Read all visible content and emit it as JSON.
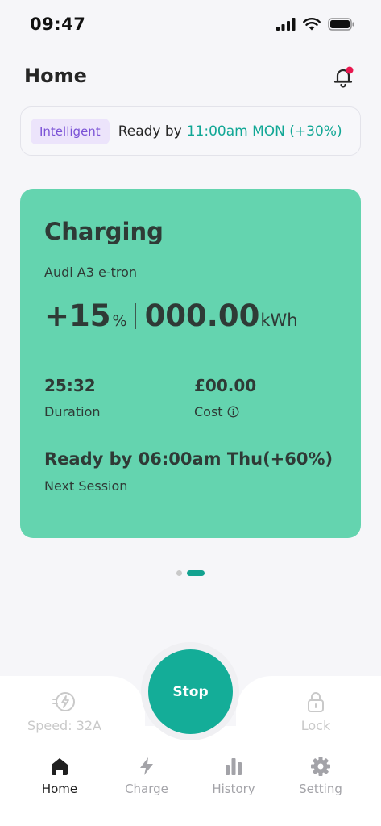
{
  "status_bar": {
    "time": "09:47"
  },
  "header": {
    "title": "Home",
    "icon": "bell-with-notification-dot"
  },
  "banner": {
    "badge": "Intelligent",
    "text": "Ready by",
    "accent": "11:00am MON (+30%)"
  },
  "card": {
    "title": "Charging",
    "vehicle": "Audi A3 e-tron",
    "percent": "+15",
    "percent_unit": "%",
    "energy": "000.00",
    "energy_unit": "kWh",
    "duration_value": "25:32",
    "duration_label": "Duration",
    "cost_value": "£00.00",
    "cost_label": "Cost",
    "ready_text": "Ready by 06:00am Thu(+60%)",
    "next_label": "Next Session"
  },
  "pager": {
    "active_index": 1,
    "count": 2
  },
  "controls": {
    "speed_label": "Speed: 32A",
    "stop_label": "Stop",
    "lock_label": "Lock"
  },
  "tabs": [
    {
      "label": "Home",
      "icon": "home-icon",
      "active": true
    },
    {
      "label": "Charge",
      "icon": "bolt-icon",
      "active": false
    },
    {
      "label": "History",
      "icon": "bar-chart-icon",
      "active": false
    },
    {
      "label": "Setting",
      "icon": "gear-icon",
      "active": false
    }
  ],
  "colors": {
    "accent": "#14ad98",
    "card_bg": "#64d4af",
    "badge_bg": "#ece4fb",
    "badge_text": "#7a52d6",
    "notification_dot": "#e8174f"
  }
}
